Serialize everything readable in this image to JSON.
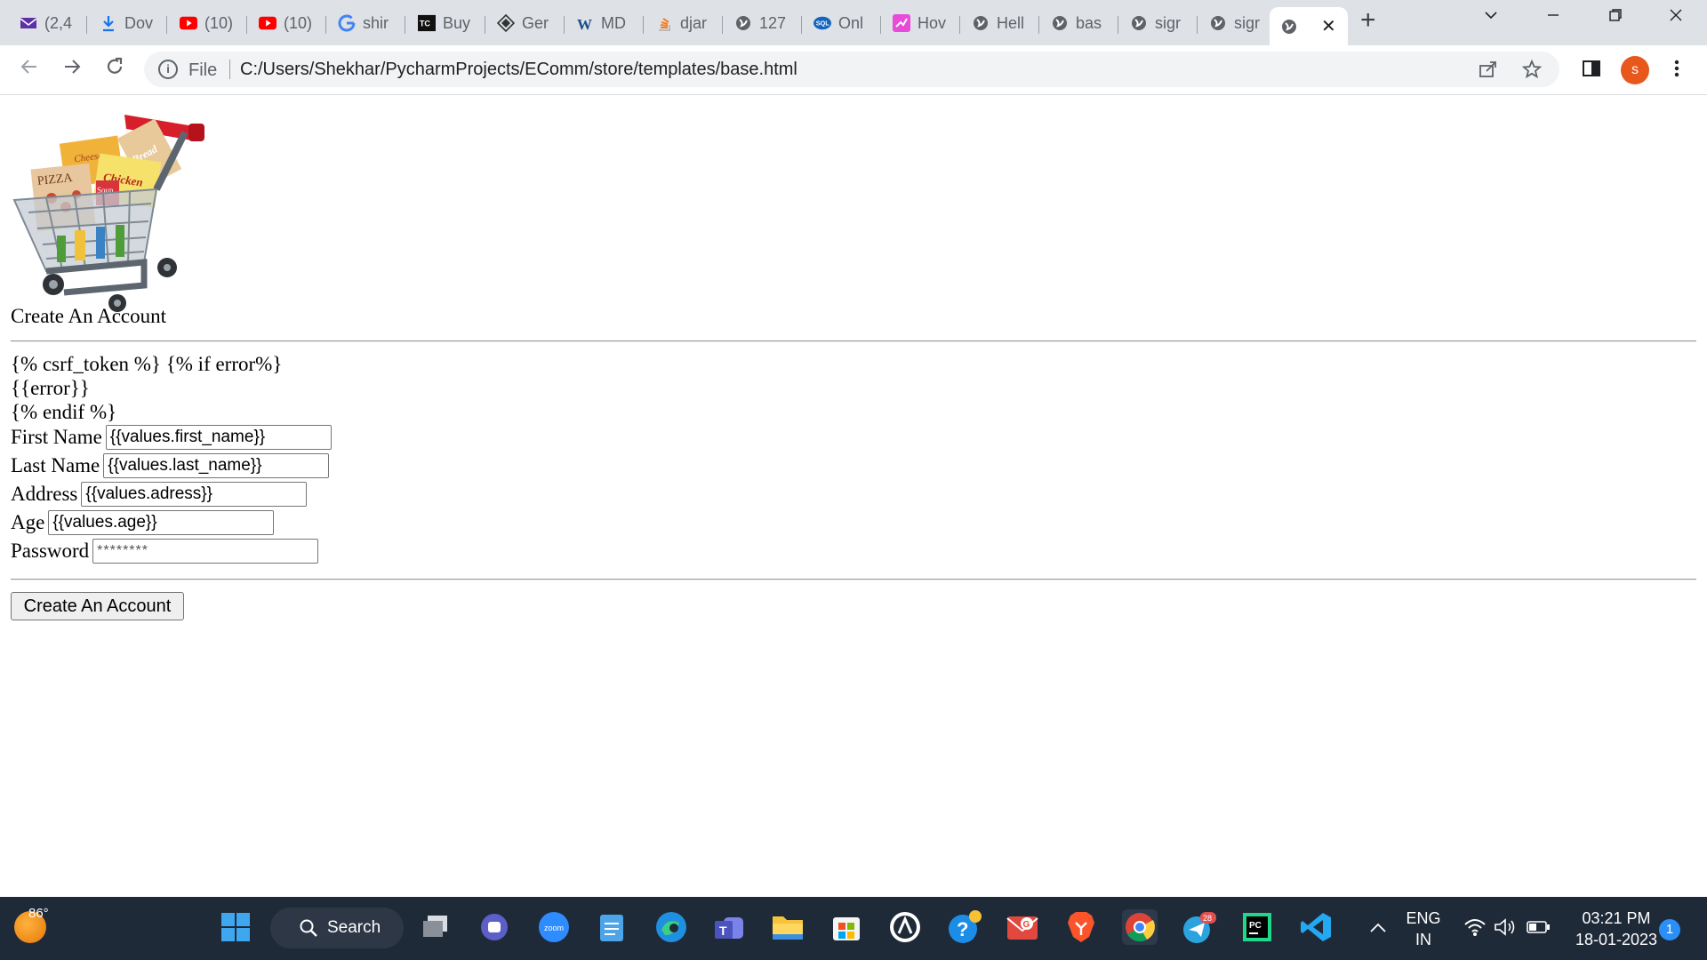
{
  "browser": {
    "tabs": [
      {
        "title": "(2,4",
        "icon": "mail-icon"
      },
      {
        "title": "Dov",
        "icon": "download-icon"
      },
      {
        "title": "(10)",
        "icon": "youtube-icon"
      },
      {
        "title": "(10)",
        "icon": "youtube-icon"
      },
      {
        "title": "shir",
        "icon": "google-icon"
      },
      {
        "title": "Buy",
        "icon": "tc-icon"
      },
      {
        "title": "Ger",
        "icon": "diamond-icon"
      },
      {
        "title": "MD",
        "icon": "w-icon"
      },
      {
        "title": "djar",
        "icon": "stackoverflow-icon"
      },
      {
        "title": "127",
        "icon": "globe-icon"
      },
      {
        "title": "Onl",
        "icon": "sql-icon"
      },
      {
        "title": "Hov",
        "icon": "pink-chart-icon"
      },
      {
        "title": "Hell",
        "icon": "globe-icon"
      },
      {
        "title": "bas",
        "icon": "globe-icon"
      },
      {
        "title": "sigr",
        "icon": "globe-icon"
      },
      {
        "title": "sigr",
        "icon": "globe-icon"
      }
    ],
    "active_tab_close": "✕",
    "new_tab": "+",
    "address": {
      "info_label": "File",
      "url": "C:/Users/Shekhar/PycharmProjects/EComm/store/templates/base.html"
    },
    "profile_initial": "s"
  },
  "page": {
    "heading": "Create An Account",
    "template_lines": [
      "{% csrf_token %}  {% if error%}",
      "{{error}}",
      "{% endif %}"
    ],
    "fields": {
      "first_name": {
        "label": "First Name",
        "value": "{{values.first_name}}"
      },
      "last_name": {
        "label": "Last Name",
        "value": "{{values.last_name}}"
      },
      "address": {
        "label": "Address",
        "value": "{{values.adress}}"
      },
      "age": {
        "label": "Age",
        "value": "{{values.age}}"
      },
      "password": {
        "label": "Password",
        "value": "********"
      }
    },
    "submit_label": "Create An Account",
    "cart_labels": [
      "Bread",
      "Cheese",
      "Chicken",
      "PIZZA",
      "Soup"
    ]
  },
  "taskbar": {
    "weather": "86°",
    "search_label": "Search",
    "apps": [
      "windows-start-icon",
      "search-icon",
      "task-view-icon",
      "chat-icon",
      "zoom-icon",
      "notepad-icon",
      "edge-icon",
      "teams-icon",
      "file-explorer-icon",
      "store-icon",
      "github-icon",
      "help-icon",
      "mail-icon",
      "brave-icon",
      "chrome-icon",
      "telegram-icon",
      "pycharm-icon",
      "vscode-icon"
    ],
    "zoom_label": "zoom",
    "telegram_badge": "28",
    "language": [
      "ENG",
      "IN"
    ],
    "time": "03:21 PM",
    "date": "18-01-2023",
    "notifications": "1"
  }
}
